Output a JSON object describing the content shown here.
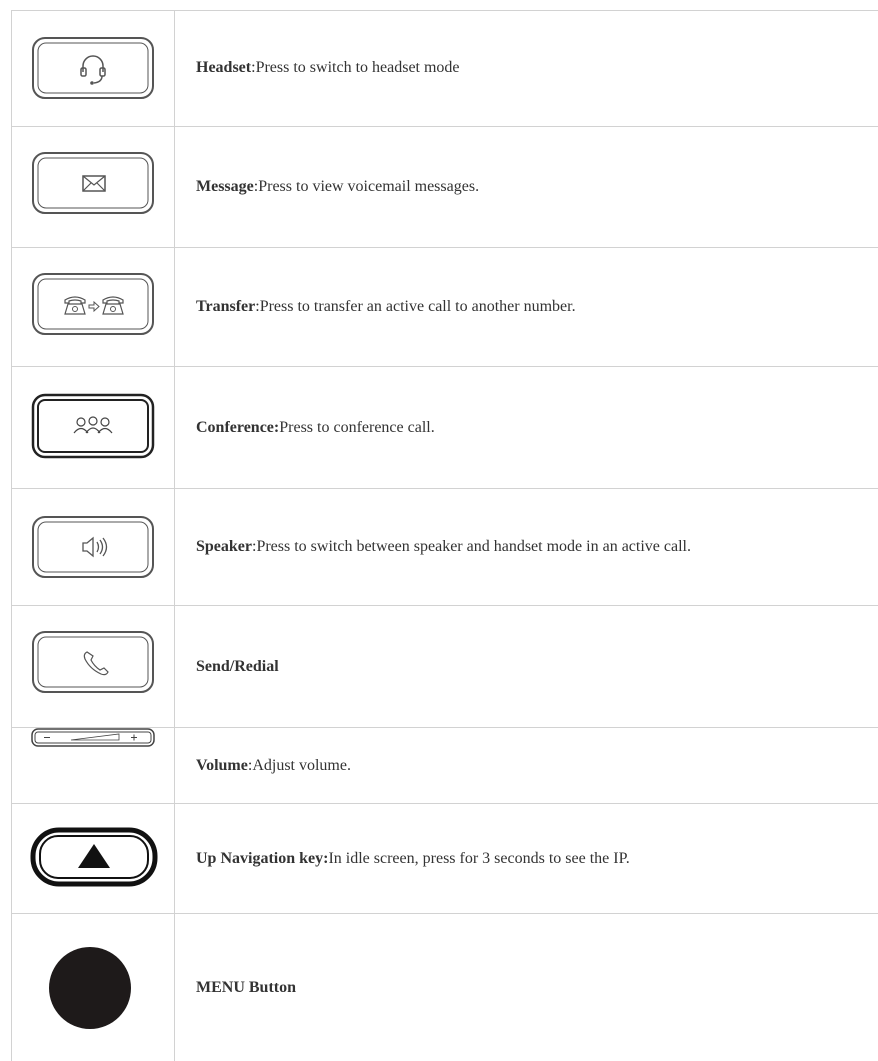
{
  "rows": [
    {
      "icon": "headset-icon",
      "label": "Headset",
      "separator": ": ",
      "text": "Press to switch to headset mode"
    },
    {
      "icon": "envelope-icon",
      "label": "Message",
      "separator": ": ",
      "text": "Press to view voicemail messages."
    },
    {
      "icon": "transfer-icon",
      "label": "Transfer",
      "separator": ": ",
      "text": "Press to transfer an active call to another number."
    },
    {
      "icon": "conference-icon",
      "label": "Conference:",
      "separator": " ",
      "text": "Press to conference call."
    },
    {
      "icon": "speaker-icon",
      "label": "Speaker",
      "separator": ": ",
      "text": "Press to switch between speaker and handset mode in an active call."
    },
    {
      "icon": "phone-handset-icon",
      "label": "Send/Redial",
      "separator": "",
      "text": ""
    },
    {
      "icon": "volume-bar-icon",
      "label": "Volume",
      "separator": ": ",
      "text": "Adjust volume."
    },
    {
      "icon": "up-arrow-icon",
      "label": "Up Navigation key:",
      "separator": " ",
      "text": "In idle screen, press for 3 seconds to see the IP."
    },
    {
      "icon": "menu-circle-icon",
      "label": "MENU Button",
      "separator": "",
      "text": ""
    }
  ],
  "colors": {
    "border": "#d2d2d2",
    "text": "#333333",
    "icon": "#333333"
  }
}
